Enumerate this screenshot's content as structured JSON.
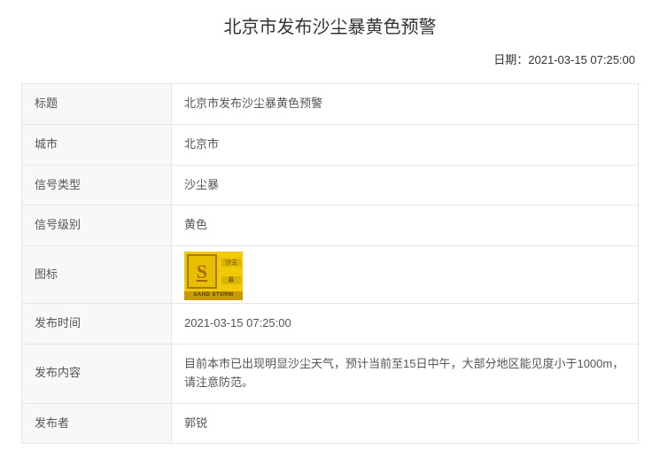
{
  "page_title": "北京市发布沙尘暴黄色预警",
  "date_label": "日期：",
  "date_value": "2021-03-15 07:25:00",
  "icon": {
    "semantic": "sandstorm-yellow-warning-icon",
    "letter": "S",
    "cn_top": "沙尘",
    "cn_bottom": "暴",
    "en_label": "SAND STORM"
  },
  "rows": {
    "title": {
      "label": "标题",
      "value": "北京市发布沙尘暴黄色预警"
    },
    "city": {
      "label": "城市",
      "value": "北京市"
    },
    "signal_type": {
      "label": "信号类型",
      "value": "沙尘暴"
    },
    "signal_level": {
      "label": "信号级别",
      "value": "黄色"
    },
    "icon_row": {
      "label": "图标"
    },
    "publish_time": {
      "label": "发布时间",
      "value": "2021-03-15 07:25:00"
    },
    "content": {
      "label": "发布内容",
      "value": "目前本市已出现明显沙尘天气，预计当前至15日中午，大部分地区能见度小于1000m，请注意防范。"
    },
    "publisher": {
      "label": "发布者",
      "value": "郭锐"
    }
  }
}
